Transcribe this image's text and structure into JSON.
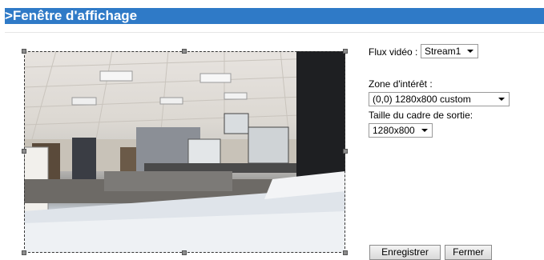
{
  "window": {
    "title": ">Fenêtre d'affichage"
  },
  "stream": {
    "label": "Flux vidéo :",
    "value": "Stream1"
  },
  "roi": {
    "label": "Zone d'intérêt :",
    "value": "(0,0) 1280x800 custom"
  },
  "output": {
    "label": "Taille du cadre de sortie:",
    "value": "1280x800"
  },
  "buttons": {
    "save": "Enregistrer",
    "close": "Fermer"
  },
  "colors": {
    "title_bar": "#2f7ac7",
    "title_text": "#ffffff"
  }
}
